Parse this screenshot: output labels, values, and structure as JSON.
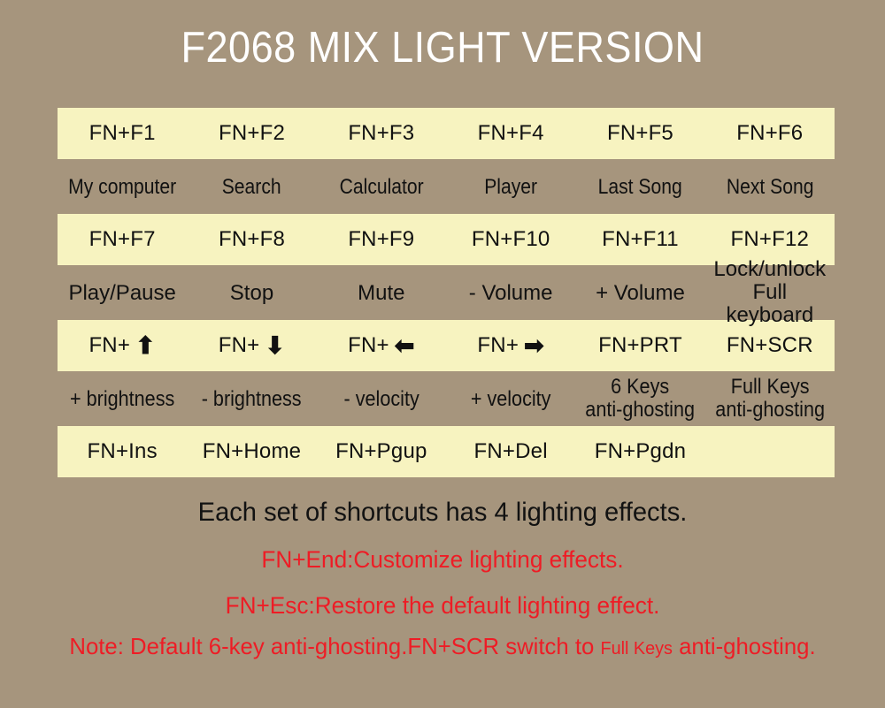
{
  "title": "F2068 MIX LIGHT VERSION",
  "colors": {
    "background": "#a6957d",
    "band": "#f7f3c0",
    "title_text": "#ffffff",
    "body_text": "#111111",
    "accent_red": "#ee1c25"
  },
  "grid": {
    "rows": [
      {
        "keys": [
          "FN+F1",
          "FN+F2",
          "FN+F3",
          "FN+F4",
          "FN+F5",
          "FN+F6"
        ],
        "descriptions": [
          "My computer",
          "Search",
          "Calculator",
          "Player",
          "Last Song",
          "Next Song"
        ]
      },
      {
        "keys": [
          "FN+F7",
          "FN+F8",
          "FN+F9",
          "FN+F10",
          "FN+F11",
          "FN+F12"
        ],
        "descriptions": [
          "Play/Pause",
          "Stop",
          "Mute",
          "- Volume",
          "+ Volume",
          "Lock/unlock\nFull keyboard"
        ]
      },
      {
        "keys": [
          "FN+",
          "FN+",
          "FN+",
          "FN+",
          "FN+PRT",
          "FN+SCR"
        ],
        "key_icons": [
          "arrow-up",
          "arrow-down",
          "arrow-left",
          "arrow-right",
          "",
          ""
        ],
        "descriptions": [
          "+ brightness",
          "- brightness",
          "- velocity",
          "+ velocity",
          "6 Keys\nanti-ghosting",
          "Full Keys\nanti-ghosting"
        ]
      },
      {
        "keys": [
          "FN+Ins",
          "FN+Home",
          "FN+Pgup",
          "FN+Del",
          "FN+Pgdn",
          ""
        ],
        "descriptions": [
          "",
          "",
          "",
          "",
          "",
          ""
        ]
      }
    ]
  },
  "notes": {
    "effects": "Each set of shortcuts has 4 lighting effects.",
    "customize": "FN+End:Customize lighting effects.",
    "restore": "FN+Esc:Restore the default lighting effect.",
    "default_prefix": "Note: Default 6-key anti-ghosting.FN+SCR switch to ",
    "default_small": "Full Keys",
    "default_suffix": " anti-ghosting."
  }
}
